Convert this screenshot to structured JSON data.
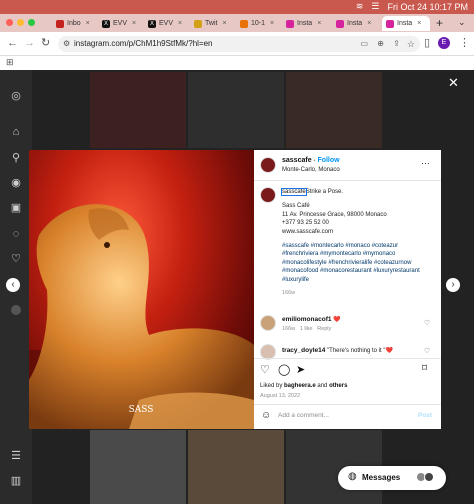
{
  "menubar": {
    "datetime": "Fri Oct 24  10:17 PM",
    "accent": "#c9594f"
  },
  "tabs": [
    {
      "label": "Inbo",
      "fav": "#c5221f"
    },
    {
      "label": "EVV",
      "fav": "#111111"
    },
    {
      "label": "EVV",
      "fav": "#111111"
    },
    {
      "label": "Twit",
      "fav": "#d4a017"
    },
    {
      "label": "10-1",
      "fav": "#e8710a"
    },
    {
      "label": "Insta",
      "fav": "#d6249f"
    },
    {
      "label": "Insta",
      "fav": "#d6249f"
    },
    {
      "label": "Insta",
      "fav": "#d6249f"
    }
  ],
  "address": {
    "url": "instagram.com/p/ChM1h9StfMk/?hl=en",
    "profile_initial": "E"
  },
  "post": {
    "username": "sasscafe",
    "follow": "Follow",
    "dot": "•",
    "location": "Monte-Carlo, Monaco",
    "caption_user": "sasscafe",
    "caption_first": "Strike a Pose.",
    "caption_lines": [
      "Sass Café",
      "11 Av. Princesse Grace, 98000 Monaco",
      "+377 93 25 52 00",
      "www.sasscafe.com"
    ],
    "hashtags": "#sasscafe #montecarlo #monaco #coteazur #frenchriviera #mymontecarlo #mymonaco #monacolifestyle #frenchrivieralife #coteazurnow #monacofood #monacorestaurant #luxuryrestaurant #luxurylife",
    "caption_age": "166w",
    "comments": [
      {
        "user": "emiliomonacof1",
        "text": "❤️",
        "age": "166w",
        "likes": "1 like",
        "reply": "Reply"
      },
      {
        "user": "tracy_doyle14",
        "text": "\"There's nothing to it \"❤️"
      }
    ],
    "liked_prefix": "Liked by ",
    "liked_user": "bagheera.e",
    "liked_and": " and ",
    "liked_others": "others",
    "date": "August 13, 2022",
    "comment_placeholder": "Add a comment...",
    "post_button": "Post"
  },
  "messages": {
    "label": "Messages"
  }
}
